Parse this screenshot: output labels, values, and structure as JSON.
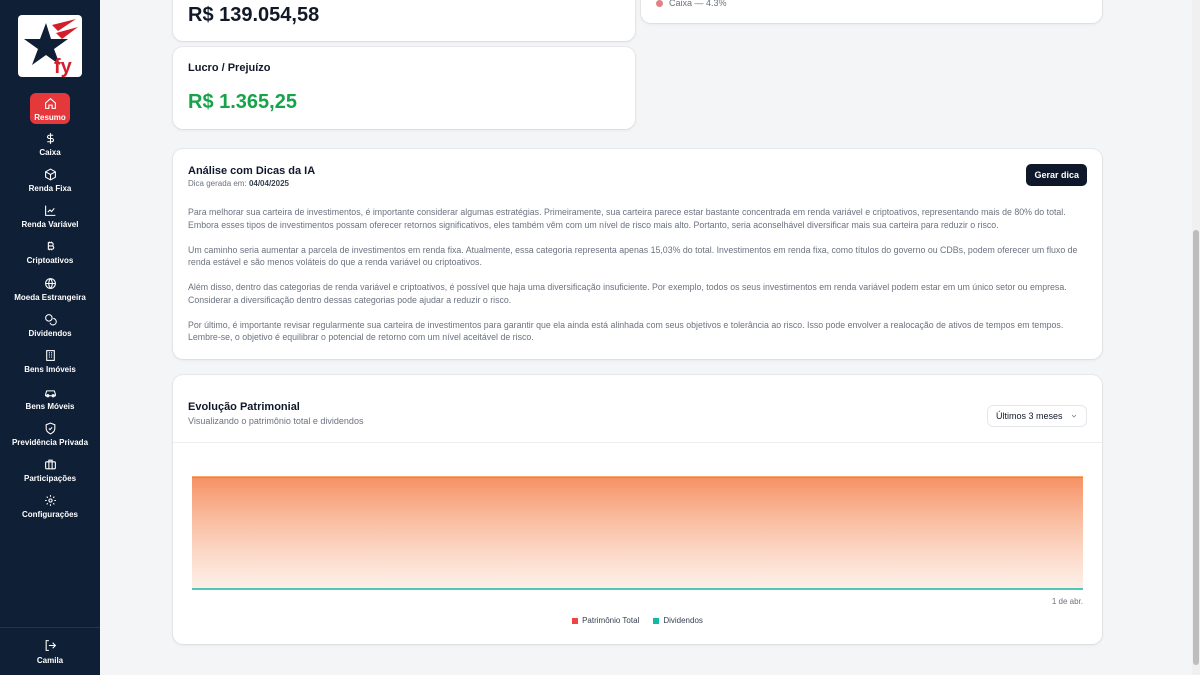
{
  "sidebar": {
    "items": [
      {
        "label": "Resumo",
        "icon": "home-icon",
        "active": true
      },
      {
        "label": "Caixa",
        "icon": "dollar-icon"
      },
      {
        "label": "Renda Fixa",
        "icon": "box-icon"
      },
      {
        "label": "Renda Variável",
        "icon": "line-chart-icon"
      },
      {
        "label": "Criptoativos",
        "icon": "bitcoin-icon"
      },
      {
        "label": "Moeda Estrangeira",
        "icon": "globe-icon"
      },
      {
        "label": "Dividendos",
        "icon": "coins-icon"
      },
      {
        "label": "Bens Imóveis",
        "icon": "building-icon"
      },
      {
        "label": "Bens Móveis",
        "icon": "car-icon"
      },
      {
        "label": "Previdência Privada",
        "icon": "shield-icon"
      },
      {
        "label": "Participações",
        "icon": "briefcase-icon"
      },
      {
        "label": "Configurações",
        "icon": "gear-icon"
      }
    ],
    "user": {
      "label": "Camila",
      "icon": "logout-icon"
    }
  },
  "summary": {
    "total_value": "R$ 139.054,58",
    "profit_label": "Lucro / Prejuízo",
    "profit_value": "R$ 1.365,25",
    "allocation_item": "Caixa — 4.3%"
  },
  "ai": {
    "title": "Análise com Dicas da IA",
    "generated_prefix": "Dica gerada em:",
    "generated_date": "04/04/2025",
    "button": "Gerar dica",
    "paragraphs": [
      "Para melhorar sua carteira de investimentos, é importante considerar algumas estratégias. Primeiramente, sua carteira parece estar bastante concentrada em renda variável e criptoativos, representando mais de 80% do total. Embora esses tipos de investimentos possam oferecer retornos significativos, eles também vêm com um nível de risco mais alto. Portanto, seria aconselhável diversificar mais sua carteira para reduzir o risco.",
      "Um caminho seria aumentar a parcela de investimentos em renda fixa. Atualmente, essa categoria representa apenas 15,03% do total. Investimentos em renda fixa, como títulos do governo ou CDBs, podem oferecer um fluxo de renda estável e são menos voláteis do que a renda variável ou criptoativos.",
      "Além disso, dentro das categorias de renda variável e criptoativos, é possível que haja uma diversificação insuficiente. Por exemplo, todos os seus investimentos em renda variável podem estar em um único setor ou empresa. Considerar a diversificação dentro dessas categorias pode ajudar a reduzir o risco.",
      "Por último, é importante revisar regularmente sua carteira de investimentos para garantir que ela ainda está alinhada com seus objetivos e tolerância ao risco. Isso pode envolver a realocação de ativos de tempos em tempos. Lembre-se, o objetivo é equilibrar o potencial de retorno com um nível aceitável de risco."
    ]
  },
  "chart_card": {
    "title": "Evolução Patrimonial",
    "subtitle": "Visualizando o patrimônio total e dividendos",
    "period_select": "Últimos 3 meses"
  },
  "chart_data": {
    "type": "area",
    "x": [
      "1 de abr."
    ],
    "series": [
      {
        "name": "Patrimônio Total",
        "values": [
          139054.58
        ],
        "color": "#f97316"
      },
      {
        "name": "Dividendos",
        "values": [
          0
        ],
        "color": "#14b8a6"
      }
    ],
    "legend_position": "bottom",
    "legend_colors": [
      "#ef4444",
      "#14b8a6"
    ],
    "grid": false
  },
  "colors": {
    "sidebar": "#0f1f35",
    "accent": "#e5383b",
    "positive": "#16a34a"
  }
}
